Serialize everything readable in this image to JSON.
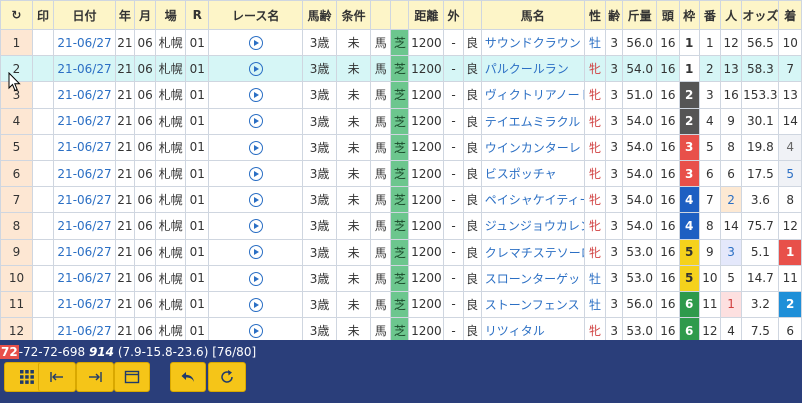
{
  "columns": [
    "↻",
    "印",
    "日付",
    "年",
    "月",
    "場",
    "R",
    "レース名",
    "馬齢",
    "条件",
    "",
    "",
    "距離",
    "外",
    "",
    "馬名",
    "性",
    "齢",
    "斤量",
    "頭",
    "枠",
    "番",
    "人",
    "オッズ",
    "着"
  ],
  "rows": [
    {
      "n": "1",
      "date": "21-06/27",
      "yr": "21",
      "mo": "06",
      "place": "札幌",
      "r": "01",
      "age": "3歳",
      "cond": "未",
      "kind": "馬",
      "surface": "芝",
      "dist": "1200",
      "out": "-",
      "going": "良",
      "name": "サウンドクラウン",
      "sex": "牡",
      "sage": "3",
      "kin": "56.0",
      "heads": "16",
      "waku": "1",
      "wk": "w1",
      "ban": "1",
      "ninki": "12",
      "nk": "",
      "odds": "56.5",
      "chaku": "10",
      "ck": ""
    },
    {
      "n": "2",
      "date": "21-06/27",
      "yr": "21",
      "mo": "06",
      "place": "札幌",
      "r": "01",
      "age": "3歳",
      "cond": "未",
      "kind": "馬",
      "surface": "芝",
      "dist": "1200",
      "out": "-",
      "going": "良",
      "name": "パルクールラン",
      "sex": "牝",
      "sage": "3",
      "kin": "54.0",
      "heads": "16",
      "waku": "1",
      "wk": "w1",
      "ban": "2",
      "ninki": "13",
      "nk": "",
      "odds": "58.3",
      "chaku": "7",
      "ck": "",
      "sel": true
    },
    {
      "n": "3",
      "date": "21-06/27",
      "yr": "21",
      "mo": "06",
      "place": "札幌",
      "r": "01",
      "age": "3歳",
      "cond": "未",
      "kind": "馬",
      "surface": "芝",
      "dist": "1200",
      "out": "-",
      "going": "良",
      "name": "ヴィクトリアノート",
      "sex": "牝",
      "sage": "3",
      "kin": "51.0",
      "heads": "16",
      "waku": "2",
      "wk": "w2",
      "ban": "3",
      "ninki": "16",
      "nk": "",
      "odds": "153.3",
      "chaku": "13",
      "ck": ""
    },
    {
      "n": "4",
      "date": "21-06/27",
      "yr": "21",
      "mo": "06",
      "place": "札幌",
      "r": "01",
      "age": "3歳",
      "cond": "未",
      "kind": "馬",
      "surface": "芝",
      "dist": "1200",
      "out": "-",
      "going": "良",
      "name": "テイエムミラクル",
      "sex": "牝",
      "sage": "3",
      "kin": "54.0",
      "heads": "16",
      "waku": "2",
      "wk": "w2",
      "ban": "4",
      "ninki": "9",
      "nk": "",
      "odds": "30.1",
      "chaku": "14",
      "ck": ""
    },
    {
      "n": "5",
      "date": "21-06/27",
      "yr": "21",
      "mo": "06",
      "place": "札幌",
      "r": "01",
      "age": "3歳",
      "cond": "未",
      "kind": "馬",
      "surface": "芝",
      "dist": "1200",
      "out": "-",
      "going": "良",
      "name": "ウインカンターレ",
      "sex": "牝",
      "sage": "3",
      "kin": "54.0",
      "heads": "16",
      "waku": "3",
      "wk": "w3",
      "ban": "5",
      "ninki": "8",
      "nk": "",
      "odds": "19.8",
      "chaku": "4",
      "ck": "ck4"
    },
    {
      "n": "6",
      "date": "21-06/27",
      "yr": "21",
      "mo": "06",
      "place": "札幌",
      "r": "01",
      "age": "3歳",
      "cond": "未",
      "kind": "馬",
      "surface": "芝",
      "dist": "1200",
      "out": "-",
      "going": "良",
      "name": "ビスポッチャ",
      "sex": "牝",
      "sage": "3",
      "kin": "54.0",
      "heads": "16",
      "waku": "3",
      "wk": "w3",
      "ban": "6",
      "ninki": "6",
      "nk": "",
      "odds": "17.5",
      "chaku": "5",
      "ck": "ck5"
    },
    {
      "n": "7",
      "date": "21-06/27",
      "yr": "21",
      "mo": "06",
      "place": "札幌",
      "r": "01",
      "age": "3歳",
      "cond": "未",
      "kind": "馬",
      "surface": "芝",
      "dist": "1200",
      "out": "-",
      "going": "良",
      "name": "ペイシャケイティー",
      "sex": "牝",
      "sage": "3",
      "kin": "54.0",
      "heads": "16",
      "waku": "4",
      "wk": "w4",
      "ban": "7",
      "ninki": "2",
      "nk": "nk2",
      "odds": "3.6",
      "chaku": "8",
      "ck": ""
    },
    {
      "n": "8",
      "date": "21-06/27",
      "yr": "21",
      "mo": "06",
      "place": "札幌",
      "r": "01",
      "age": "3歳",
      "cond": "未",
      "kind": "馬",
      "surface": "芝",
      "dist": "1200",
      "out": "-",
      "going": "良",
      "name": "ジュンジョウカレン",
      "sex": "牝",
      "sage": "3",
      "kin": "54.0",
      "heads": "16",
      "waku": "4",
      "wk": "w4",
      "ban": "8",
      "ninki": "14",
      "nk": "",
      "odds": "75.7",
      "chaku": "12",
      "ck": ""
    },
    {
      "n": "9",
      "date": "21-06/27",
      "yr": "21",
      "mo": "06",
      "place": "札幌",
      "r": "01",
      "age": "3歳",
      "cond": "未",
      "kind": "馬",
      "surface": "芝",
      "dist": "1200",
      "out": "-",
      "going": "良",
      "name": "クレマチステソーロ",
      "sex": "牝",
      "sage": "3",
      "kin": "53.0",
      "heads": "16",
      "waku": "5",
      "wk": "w5",
      "ban": "9",
      "ninki": "3",
      "nk": "nk3",
      "odds": "5.1",
      "chaku": "1",
      "ck": "ck1"
    },
    {
      "n": "10",
      "date": "21-06/27",
      "yr": "21",
      "mo": "06",
      "place": "札幌",
      "r": "01",
      "age": "3歳",
      "cond": "未",
      "kind": "馬",
      "surface": "芝",
      "dist": "1200",
      "out": "-",
      "going": "良",
      "name": "スローンターゲット",
      "sex": "牡",
      "sage": "3",
      "kin": "53.0",
      "heads": "16",
      "waku": "5",
      "wk": "w5",
      "ban": "10",
      "ninki": "5",
      "nk": "",
      "odds": "14.7",
      "chaku": "11",
      "ck": ""
    },
    {
      "n": "11",
      "date": "21-06/27",
      "yr": "21",
      "mo": "06",
      "place": "札幌",
      "r": "01",
      "age": "3歳",
      "cond": "未",
      "kind": "馬",
      "surface": "芝",
      "dist": "1200",
      "out": "-",
      "going": "良",
      "name": "ストーンフェンス",
      "sex": "牡",
      "sage": "3",
      "kin": "56.0",
      "heads": "16",
      "waku": "6",
      "wk": "w6",
      "ban": "11",
      "ninki": "1",
      "nk": "nk1",
      "odds": "3.2",
      "chaku": "2",
      "ck": "ck2"
    },
    {
      "n": "12",
      "date": "21-06/27",
      "yr": "21",
      "mo": "06",
      "place": "札幌",
      "r": "01",
      "age": "3歳",
      "cond": "未",
      "kind": "馬",
      "surface": "芝",
      "dist": "1200",
      "out": "-",
      "going": "良",
      "name": "リツィタル",
      "sex": "牝",
      "sage": "3",
      "kin": "53.0",
      "heads": "16",
      "waku": "6",
      "wk": "w6",
      "ban": "12",
      "ninki": "4",
      "nk": "",
      "odds": "7.5",
      "chaku": "6",
      "ck": ""
    }
  ],
  "summary": {
    "highlight": "72",
    "rest": "-72-72-698 ",
    "bold": "914",
    "tail": " (7.9-15.8-23.6) [76/80]"
  },
  "toolbar": {
    "buttons": [
      "grid-icon",
      "first-icon",
      "last-icon",
      "window-icon",
      "back-icon",
      "refresh-icon"
    ]
  },
  "colors": {
    "header_bg": "#fdf5c8",
    "rownum_bg": "#fde7d3",
    "selected_row_bg": "#d6f6f6",
    "footer_bg": "#2a3e7a",
    "button_bg": "#f5c518",
    "link_blue": "#2b6fc4"
  }
}
